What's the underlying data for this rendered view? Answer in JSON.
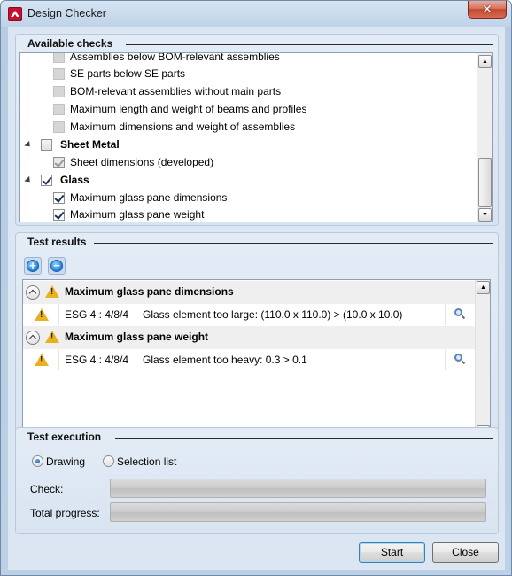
{
  "window": {
    "title": "Design Checker",
    "close_glyph": "✕"
  },
  "available_checks": {
    "title": "Available checks",
    "items": [
      {
        "label": "Assemblies below BOM-relevant assemblies",
        "type": "child",
        "checked": false,
        "disabled": true
      },
      {
        "label": "SE parts below SE parts",
        "type": "child",
        "checked": false,
        "disabled": true
      },
      {
        "label": "BOM-relevant assemblies without main parts",
        "type": "child",
        "checked": false,
        "disabled": true
      },
      {
        "label": "Maximum length and weight of beams and profiles",
        "type": "child",
        "checked": false,
        "disabled": true
      },
      {
        "label": "Maximum dimensions and weight of assemblies",
        "type": "child",
        "checked": false,
        "disabled": true
      },
      {
        "label": "Sheet Metal",
        "type": "group",
        "checked": false,
        "disabled": false
      },
      {
        "label": "Sheet dimensions (developed)",
        "type": "child",
        "checked": true,
        "disabled": true
      },
      {
        "label": "Glass",
        "type": "group",
        "checked": true,
        "disabled": false
      },
      {
        "label": "Maximum glass pane dimensions",
        "type": "child",
        "checked": true,
        "disabled": false
      },
      {
        "label": "Maximum glass pane weight",
        "type": "child",
        "checked": true,
        "disabled": false
      }
    ]
  },
  "test_results": {
    "title": "Test results",
    "expand_glyph": "+",
    "collapse_glyph": "−",
    "groups": [
      {
        "header": "Maximum glass pane dimensions",
        "rows": [
          {
            "element": "ESG 4 : 4/8/4",
            "message": "Glass element too large: (110.0 x 110.0) > (10.0 x 10.0)"
          }
        ]
      },
      {
        "header": "Maximum glass pane weight",
        "rows": [
          {
            "element": "ESG 4 : 4/8/4",
            "message": "Glass element too heavy: 0.3 > 0.1"
          }
        ]
      }
    ],
    "warning_glyph": "!"
  },
  "test_execution": {
    "title": "Test execution",
    "radio_drawing": "Drawing",
    "radio_selection": "Selection list",
    "selected": "Drawing",
    "check_label": "Check:",
    "total_label": "Total progress:",
    "check_progress": 0,
    "total_progress": 0
  },
  "buttons": {
    "start": "Start",
    "close": "Close"
  },
  "scroll_glyphs": {
    "up": "▲",
    "down": "▼"
  }
}
